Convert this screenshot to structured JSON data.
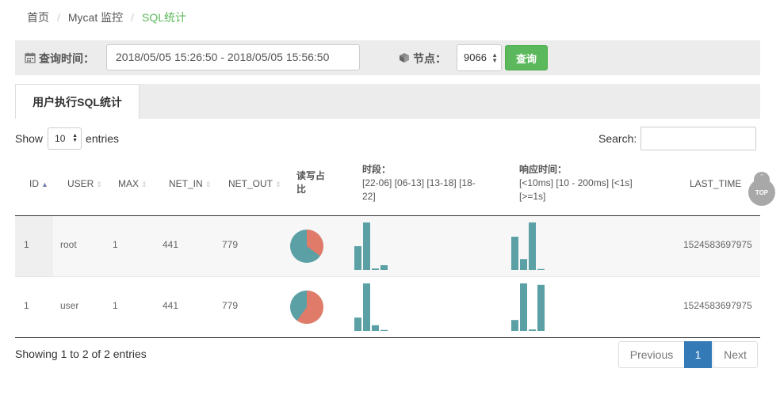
{
  "breadcrumb": {
    "home": "首页",
    "monitor": "Mycat 监控",
    "current": "SQL统计"
  },
  "query": {
    "time_label": "查询时间：",
    "time_value": "2018/05/05 15:26:50 - 2018/05/05 15:56:50",
    "node_label": "节点：",
    "node_value": "9066",
    "query_button": "查询"
  },
  "tabs": [
    {
      "label": "用户执行SQL统计"
    }
  ],
  "table_controls": {
    "show_prefix": "Show",
    "show_value": "10",
    "show_suffix": "entries",
    "search_label": "Search:",
    "search_value": ""
  },
  "columns": {
    "id": "ID",
    "user": "USER",
    "max": "MAX",
    "net_in": "NET_IN",
    "net_out": "NET_OUT",
    "rw_ratio_1": "读写占",
    "rw_ratio_2": "比",
    "period_1": "时段：",
    "period_2": "[22-06] [06-13] [13-18] [18-",
    "period_3": "22]",
    "resp_1": "响应时间：",
    "resp_2": "[<10ms] [10 - 200ms] [<1s]",
    "resp_3": "[>=1s]",
    "last_time": "LAST_TIME"
  },
  "rows": [
    {
      "id": "1",
      "user": "root",
      "max": "1",
      "net_in": "441",
      "net_out": "779",
      "last_time": "1524583697975",
      "rw_ratio": [
        0.35,
        0.65
      ],
      "period": [
        0.5,
        1.0,
        0.03,
        0.1
      ],
      "resp": [
        0.7,
        0.23,
        1.0,
        0.02
      ]
    },
    {
      "id": "1",
      "user": "user",
      "max": "1",
      "net_in": "441",
      "net_out": "779",
      "last_time": "1524583697975",
      "rw_ratio": [
        0.6,
        0.4
      ],
      "period": [
        0.28,
        1.0,
        0.12,
        0.02
      ],
      "resp": [
        0.23,
        1.0,
        0.03,
        0.97
      ]
    }
  ],
  "footer": {
    "info": "Showing 1 to 2 of 2 entries",
    "prev": "Previous",
    "page": "1",
    "next": "Next"
  },
  "back_to_top": {
    "label": "TOP",
    "arrow": "ˆ"
  },
  "colors": {
    "green": "#5cb85c",
    "teal": "#5aa0a5",
    "salmon": "#e07b6a",
    "primary": "#337ab7"
  },
  "icons": {
    "calendar": "calendar-icon",
    "cube": "cube-icon"
  }
}
